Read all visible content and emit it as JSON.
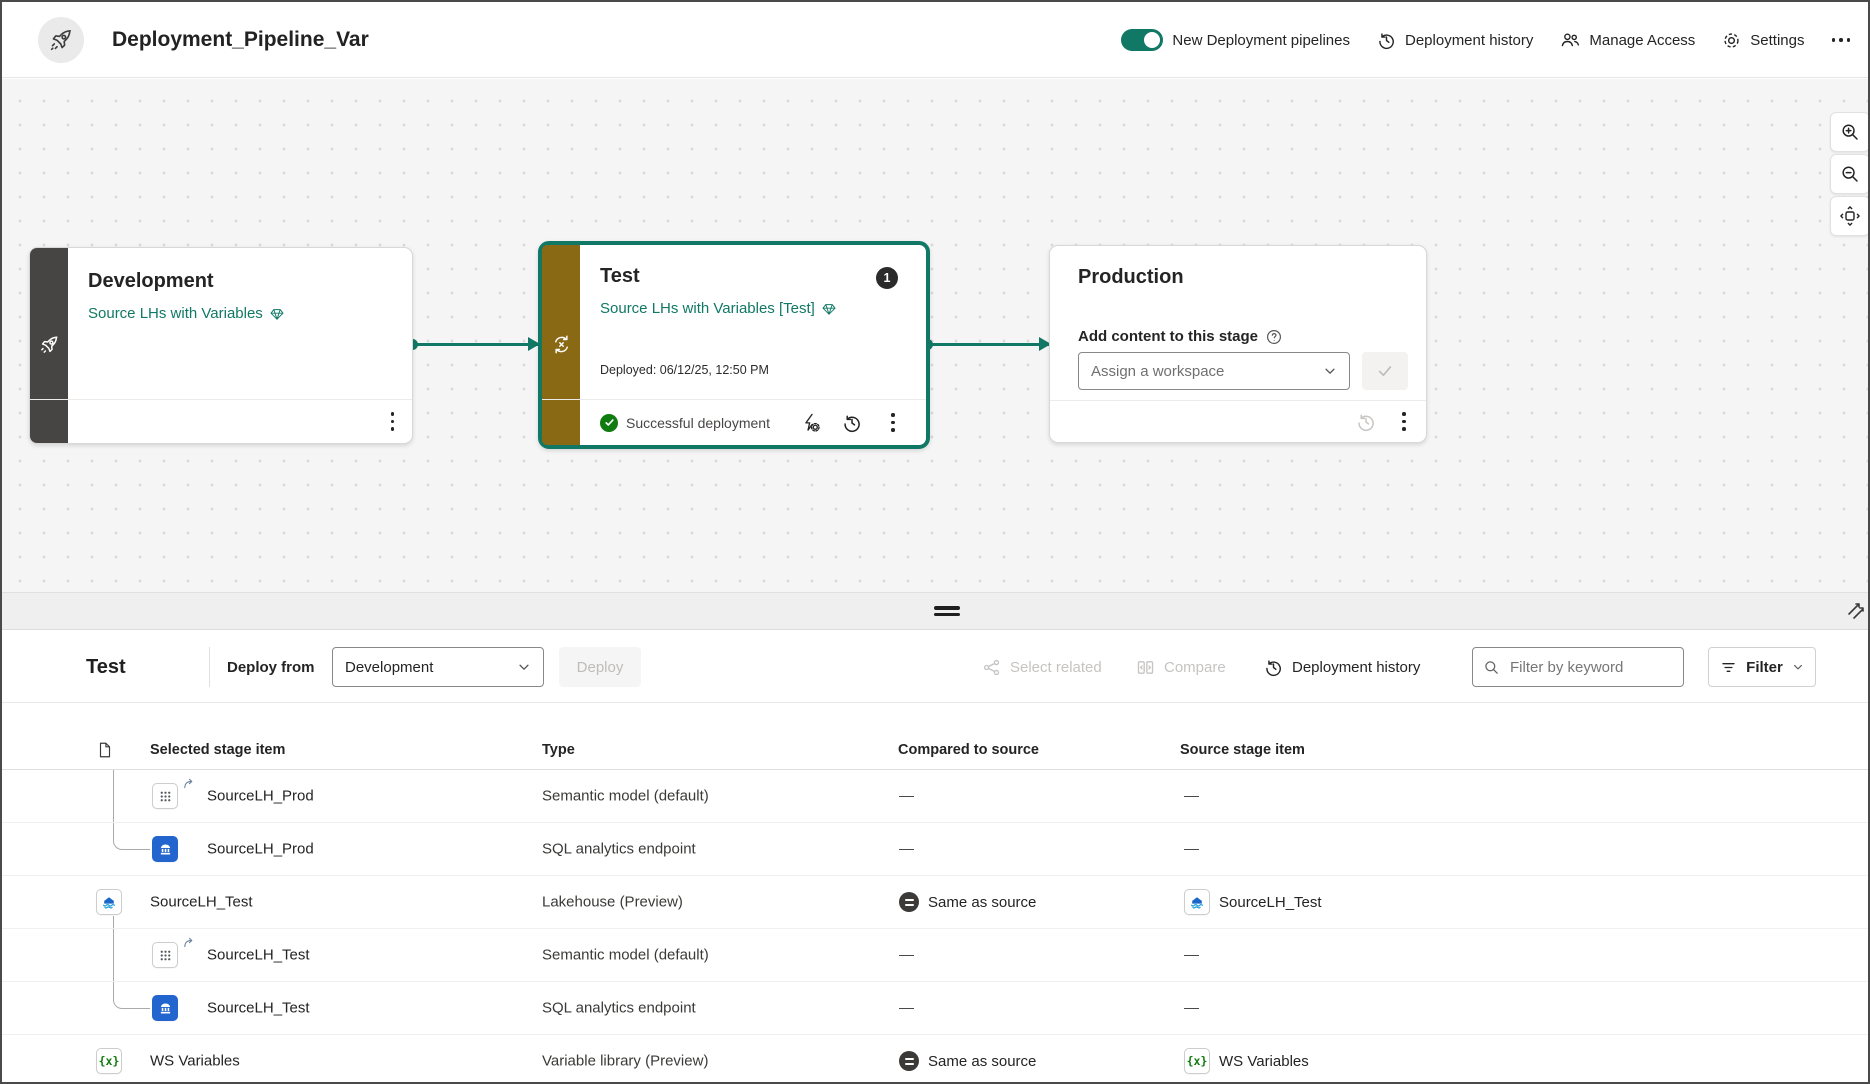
{
  "header": {
    "title": "Deployment_Pipeline_Var",
    "toggle_label": "New Deployment pipelines",
    "history": "Deployment history",
    "manage_access": "Manage Access",
    "settings": "Settings"
  },
  "stages": {
    "development": {
      "name": "Development",
      "workspace": "Source LHs with Variables"
    },
    "test": {
      "name": "Test",
      "workspace": "Source LHs with Variables [Test]",
      "badge": "1",
      "deployed": "Deployed: 06/12/25, 12:50 PM",
      "status": "Successful deployment"
    },
    "production": {
      "name": "Production",
      "add_label": "Add content to this stage",
      "assign_placeholder": "Assign a workspace"
    }
  },
  "panel": {
    "title": "Test",
    "deploy_from_label": "Deploy from",
    "deploy_from_value": "Development",
    "deploy_button": "Deploy",
    "select_related": "Select related",
    "compare": "Compare",
    "history": "Deployment history",
    "search_placeholder": "Filter by keyword",
    "filter": "Filter"
  },
  "table": {
    "h_selected": "Selected stage item",
    "h_type": "Type",
    "h_compared": "Compared to source",
    "h_source": "Source stage item",
    "rows": [
      {
        "name": "SourceLH_Prod",
        "type": "Semantic model (default)",
        "compared": "—",
        "source": "—"
      },
      {
        "name": "SourceLH_Prod",
        "type": "SQL analytics endpoint",
        "compared": "—",
        "source": "—"
      },
      {
        "name": "SourceLH_Test",
        "type": "Lakehouse (Preview)",
        "compared": "Same as source",
        "source": "SourceLH_Test"
      },
      {
        "name": "SourceLH_Test",
        "type": "Semantic model (default)",
        "compared": "—",
        "source": "—"
      },
      {
        "name": "SourceLH_Test",
        "type": "SQL analytics endpoint",
        "compared": "—",
        "source": "—"
      },
      {
        "name": "WS Variables",
        "type": "Variable library (Preview)",
        "compared": "Same as source",
        "source": "WS Variables"
      }
    ]
  },
  "colors": {
    "accent": "#117865",
    "stage_gold": "#8a6914",
    "stage_gray": "#474544",
    "success": "#107c10"
  }
}
